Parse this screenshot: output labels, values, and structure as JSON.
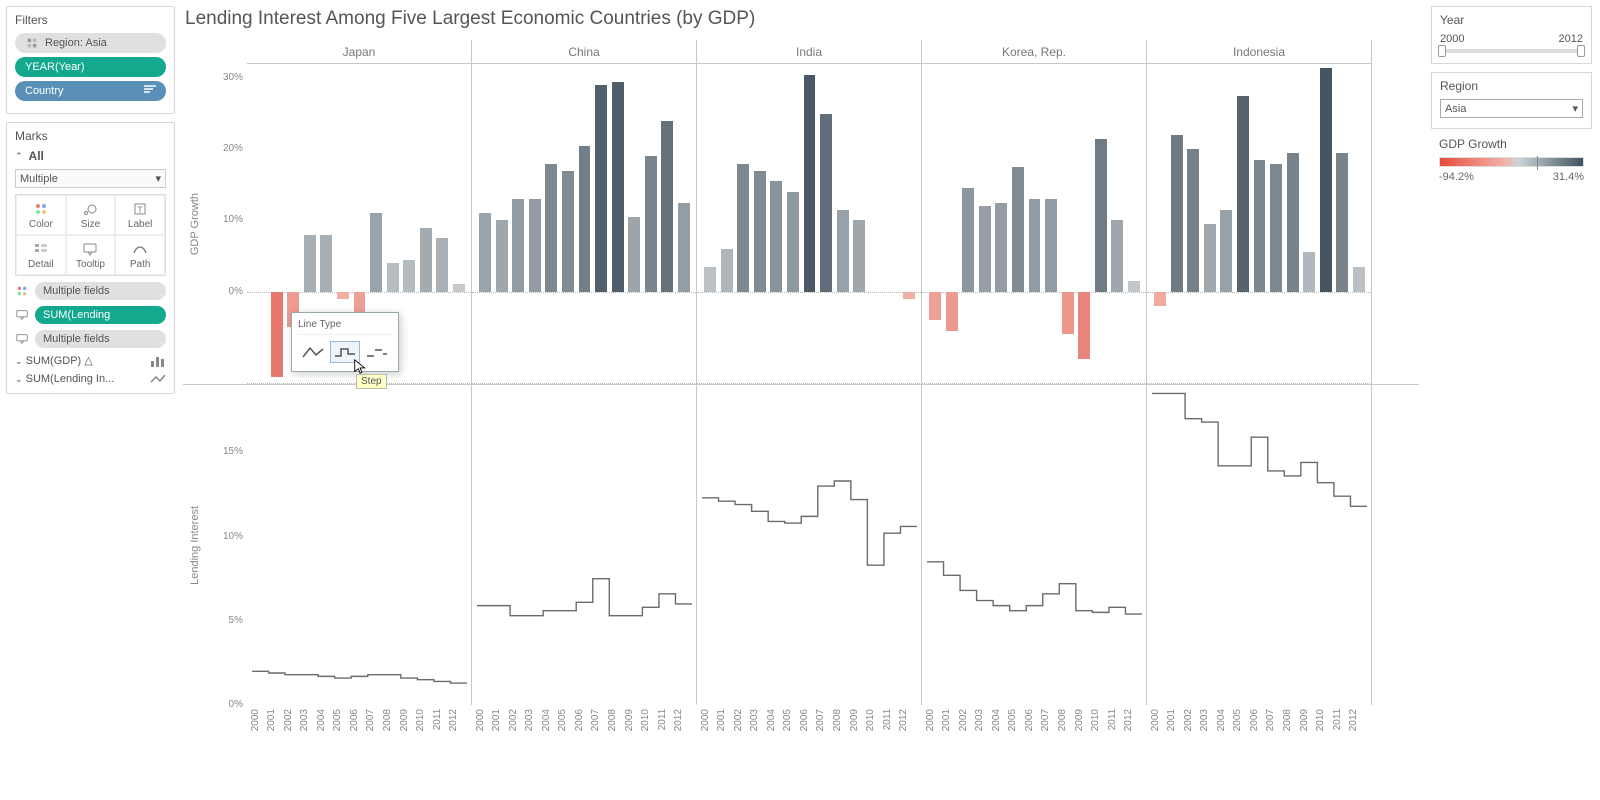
{
  "left": {
    "filters_title": "Filters",
    "filters": {
      "region": "Region: Asia",
      "year": "YEAR(Year)",
      "country": "Country"
    },
    "marks_title": "Marks",
    "all_label": "All",
    "dropdown": "Multiple",
    "cards": {
      "color": "Color",
      "size": "Size",
      "label": "Label",
      "detail": "Detail",
      "tooltip": "Tooltip",
      "path": "Path"
    },
    "shelves": {
      "mf1": "Multiple fields",
      "sum": "SUM(Lending",
      "mf2": "Multiple fields"
    },
    "collapse": {
      "gdp": "SUM(GDP)",
      "lend": "SUM(Lending In..."
    }
  },
  "chart_title": "Lending Interest Among Five Largest Economic Countries (by GDP)",
  "popup": {
    "title": "Line Type",
    "tooltip": "Step"
  },
  "right": {
    "year_title": "Year",
    "year_min": "2000",
    "year_max": "2012",
    "region_title": "Region",
    "region_value": "Asia",
    "growth_title": "GDP Growth",
    "grad_min": "-94.2%",
    "grad_max": "31.4%"
  },
  "chart_data": {
    "type": "bar+step",
    "title": "Lending Interest Among Five Largest Economic Countries (by GDP)",
    "facets": [
      "Japan",
      "China",
      "India",
      "Korea, Rep.",
      "Indonesia"
    ],
    "years": [
      2000,
      2001,
      2002,
      2003,
      2004,
      2005,
      2006,
      2007,
      2008,
      2009,
      2010,
      2011,
      2012
    ],
    "top": {
      "ylabel": "GDP Growth",
      "ylim": [
        -13,
        32
      ],
      "ticks": [
        0,
        10,
        20,
        30
      ],
      "series": {
        "Japan": [
          null,
          -12,
          -5,
          8,
          8,
          -1,
          -4,
          11,
          4,
          4.5,
          9,
          7.5,
          1
        ],
        "China": [
          11,
          10,
          13,
          13,
          18,
          17,
          20.5,
          29,
          29.5,
          10.5,
          19,
          24,
          12.5
        ],
        "India": [
          3.5,
          6,
          18,
          17,
          15.5,
          14,
          30.5,
          25,
          11.5,
          10,
          null,
          null,
          -1
        ],
        "Korea, Rep.": [
          -4,
          -5.5,
          14.5,
          12,
          12.5,
          17.5,
          13,
          13,
          -6,
          -9.5,
          21.5,
          10,
          1.5
        ],
        "Indonesia": [
          -2,
          22,
          20,
          9.5,
          11.5,
          27.5,
          18.5,
          18,
          19.5,
          5.5,
          31.5,
          19.5,
          3.5
        ]
      }
    },
    "bottom": {
      "ylabel": "Lending Interest",
      "ylim": [
        0,
        19
      ],
      "ticks": [
        0,
        5,
        10,
        15
      ],
      "series": {
        "Japan": [
          2.0,
          1.9,
          1.8,
          1.8,
          1.7,
          1.6,
          1.7,
          1.8,
          1.8,
          1.6,
          1.5,
          1.4,
          1.3
        ],
        "China": [
          5.9,
          5.9,
          5.3,
          5.3,
          5.6,
          5.6,
          6.1,
          7.5,
          5.3,
          5.3,
          5.8,
          6.6,
          6.0
        ],
        "India": [
          12.3,
          12.1,
          11.9,
          11.5,
          10.9,
          10.8,
          11.2,
          13.0,
          13.3,
          12.2,
          8.3,
          10.2,
          10.6
        ],
        "Korea, Rep.": [
          8.5,
          7.7,
          6.8,
          6.2,
          5.9,
          5.6,
          5.9,
          6.6,
          7.2,
          5.6,
          5.5,
          5.8,
          5.4
        ],
        "Indonesia": [
          18.5,
          18.5,
          17.0,
          16.8,
          14.2,
          14.2,
          15.9,
          13.9,
          13.6,
          14.4,
          13.2,
          12.4,
          11.8
        ]
      }
    }
  }
}
